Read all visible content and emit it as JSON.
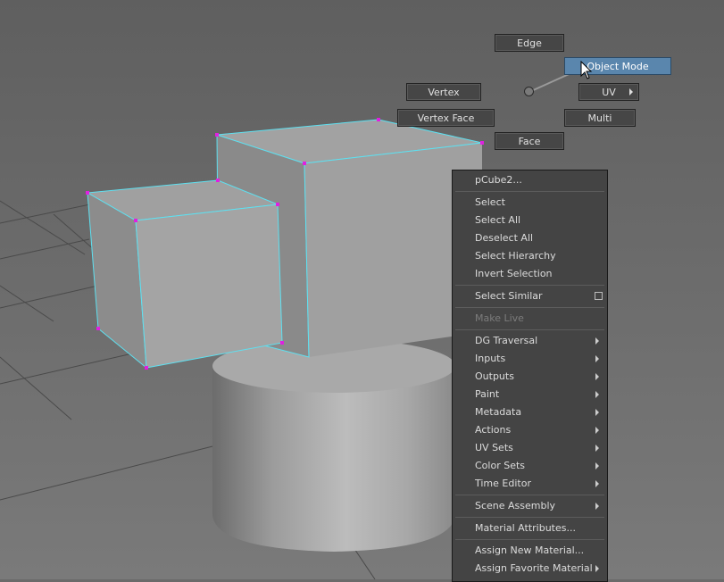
{
  "marking_menu": {
    "edge": "Edge",
    "object_mode": "Object Mode",
    "vertex": "Vertex",
    "uv": "UV",
    "vertex_face": "Vertex Face",
    "multi": "Multi",
    "face": "Face"
  },
  "context_menu": {
    "object_name": "pCube2...",
    "select": "Select",
    "select_all": "Select All",
    "deselect_all": "Deselect All",
    "select_hierarchy": "Select Hierarchy",
    "invert_selection": "Invert Selection",
    "select_similar": "Select Similar",
    "make_live": "Make Live",
    "dg_traversal": "DG Traversal",
    "inputs": "Inputs",
    "outputs": "Outputs",
    "paint": "Paint",
    "metadata": "Metadata",
    "actions": "Actions",
    "uv_sets": "UV Sets",
    "color_sets": "Color Sets",
    "time_editor": "Time Editor",
    "scene_assembly": "Scene Assembly",
    "material_attributes": "Material Attributes...",
    "assign_new_material": "Assign New Material...",
    "assign_favorite_material": "Assign Favorite Material"
  },
  "colors": {
    "viewport_bg": "#6a6a6a",
    "selection_wire": "#5ee0f0",
    "vertex": "#e020e0",
    "active_item": "#5a86ad"
  }
}
